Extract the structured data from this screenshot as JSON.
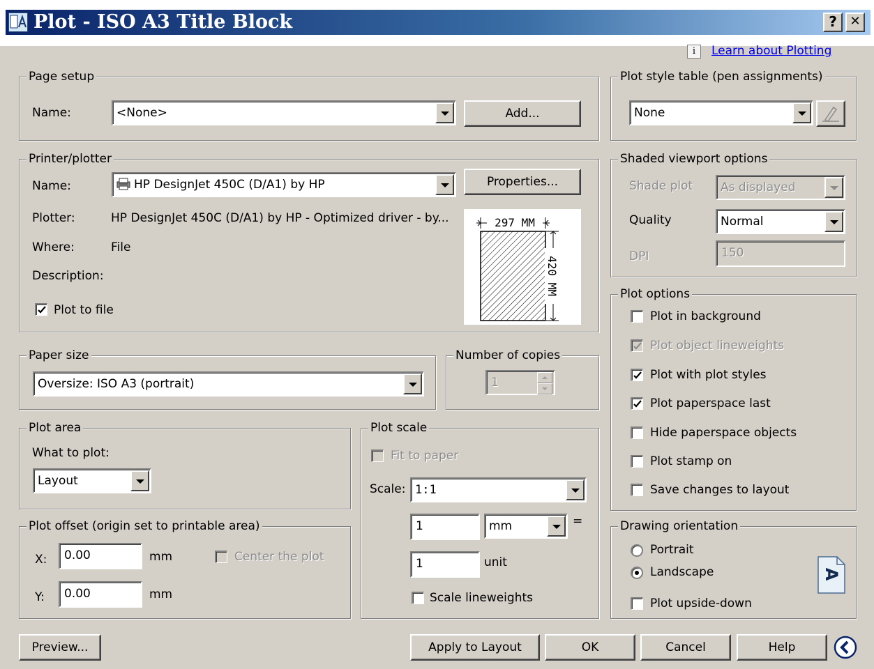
{
  "window": {
    "title": "Plot - ISO A3 Title Block",
    "help_btn": "?",
    "close_btn": "✕"
  },
  "header": {
    "learn_link": "Learn about Plotting",
    "info_glyph": "i"
  },
  "page_setup": {
    "title": "Page setup",
    "name_label": "Name:",
    "name_value": "<None>",
    "add_button": "Add..."
  },
  "printer": {
    "title": "Printer/plotter",
    "name_label": "Name:",
    "name_value": "HP DesignJet 450C (D/A1) by HP",
    "properties_button": "Properties...",
    "plotter_label": "Plotter:",
    "plotter_value": "HP DesignJet 450C (D/A1) by HP - Optimized driver - by...",
    "where_label": "Where:",
    "where_value": "File",
    "description_label": "Description:",
    "plot_to_file_label": "Plot to file",
    "plot_to_file_checked": true,
    "preview_width": "297 MM",
    "preview_height": "420 MM"
  },
  "paper_size": {
    "title": "Paper size",
    "value": "Oversize: ISO A3  (portrait)"
  },
  "copies": {
    "title": "Number of copies",
    "value": "1"
  },
  "plot_area": {
    "title": "Plot area",
    "what_label": "What to plot:",
    "what_value": "Layout"
  },
  "plot_offset": {
    "title": "Plot offset (origin set to printable area)",
    "x_label": "X:",
    "x_value": "0.00",
    "x_unit": "mm",
    "y_label": "Y:",
    "y_value": "0.00",
    "y_unit": "mm",
    "center_label": "Center the plot"
  },
  "plot_scale": {
    "title": "Plot scale",
    "fit_label": "Fit to paper",
    "scale_label": "Scale:",
    "scale_value": "1:1",
    "value1": "1",
    "unit1": "mm",
    "equals": "=",
    "value2": "1",
    "unit2": "unit",
    "lineweights_label": "Scale lineweights"
  },
  "plot_style": {
    "title": "Plot style table (pen assignments)",
    "value": "None"
  },
  "shaded": {
    "title": "Shaded viewport options",
    "shade_label": "Shade plot",
    "shade_value": "As displayed",
    "quality_label": "Quality",
    "quality_value": "Normal",
    "dpi_label": "DPI",
    "dpi_value": "150"
  },
  "plot_options": {
    "title": "Plot options",
    "items": [
      {
        "label": "Plot in background",
        "checked": false,
        "disabled": false
      },
      {
        "label": "Plot object lineweights",
        "checked": true,
        "disabled": true
      },
      {
        "label": "Plot with plot styles",
        "checked": true,
        "disabled": false
      },
      {
        "label": "Plot paperspace last",
        "checked": true,
        "disabled": false
      },
      {
        "label": "Hide paperspace objects",
        "checked": false,
        "disabled": false
      },
      {
        "label": "Plot stamp on",
        "checked": false,
        "disabled": false
      },
      {
        "label": "Save changes to layout",
        "checked": false,
        "disabled": false
      }
    ]
  },
  "orientation": {
    "title": "Drawing orientation",
    "portrait_label": "Portrait",
    "landscape_label": "Landscape",
    "upside_label": "Plot upside-down",
    "selected": "Landscape",
    "icon_glyph": "A"
  },
  "footer": {
    "preview_button": "Preview...",
    "apply_button": "Apply to Layout",
    "ok_button": "OK",
    "cancel_button": "Cancel",
    "help_button": "Help"
  }
}
